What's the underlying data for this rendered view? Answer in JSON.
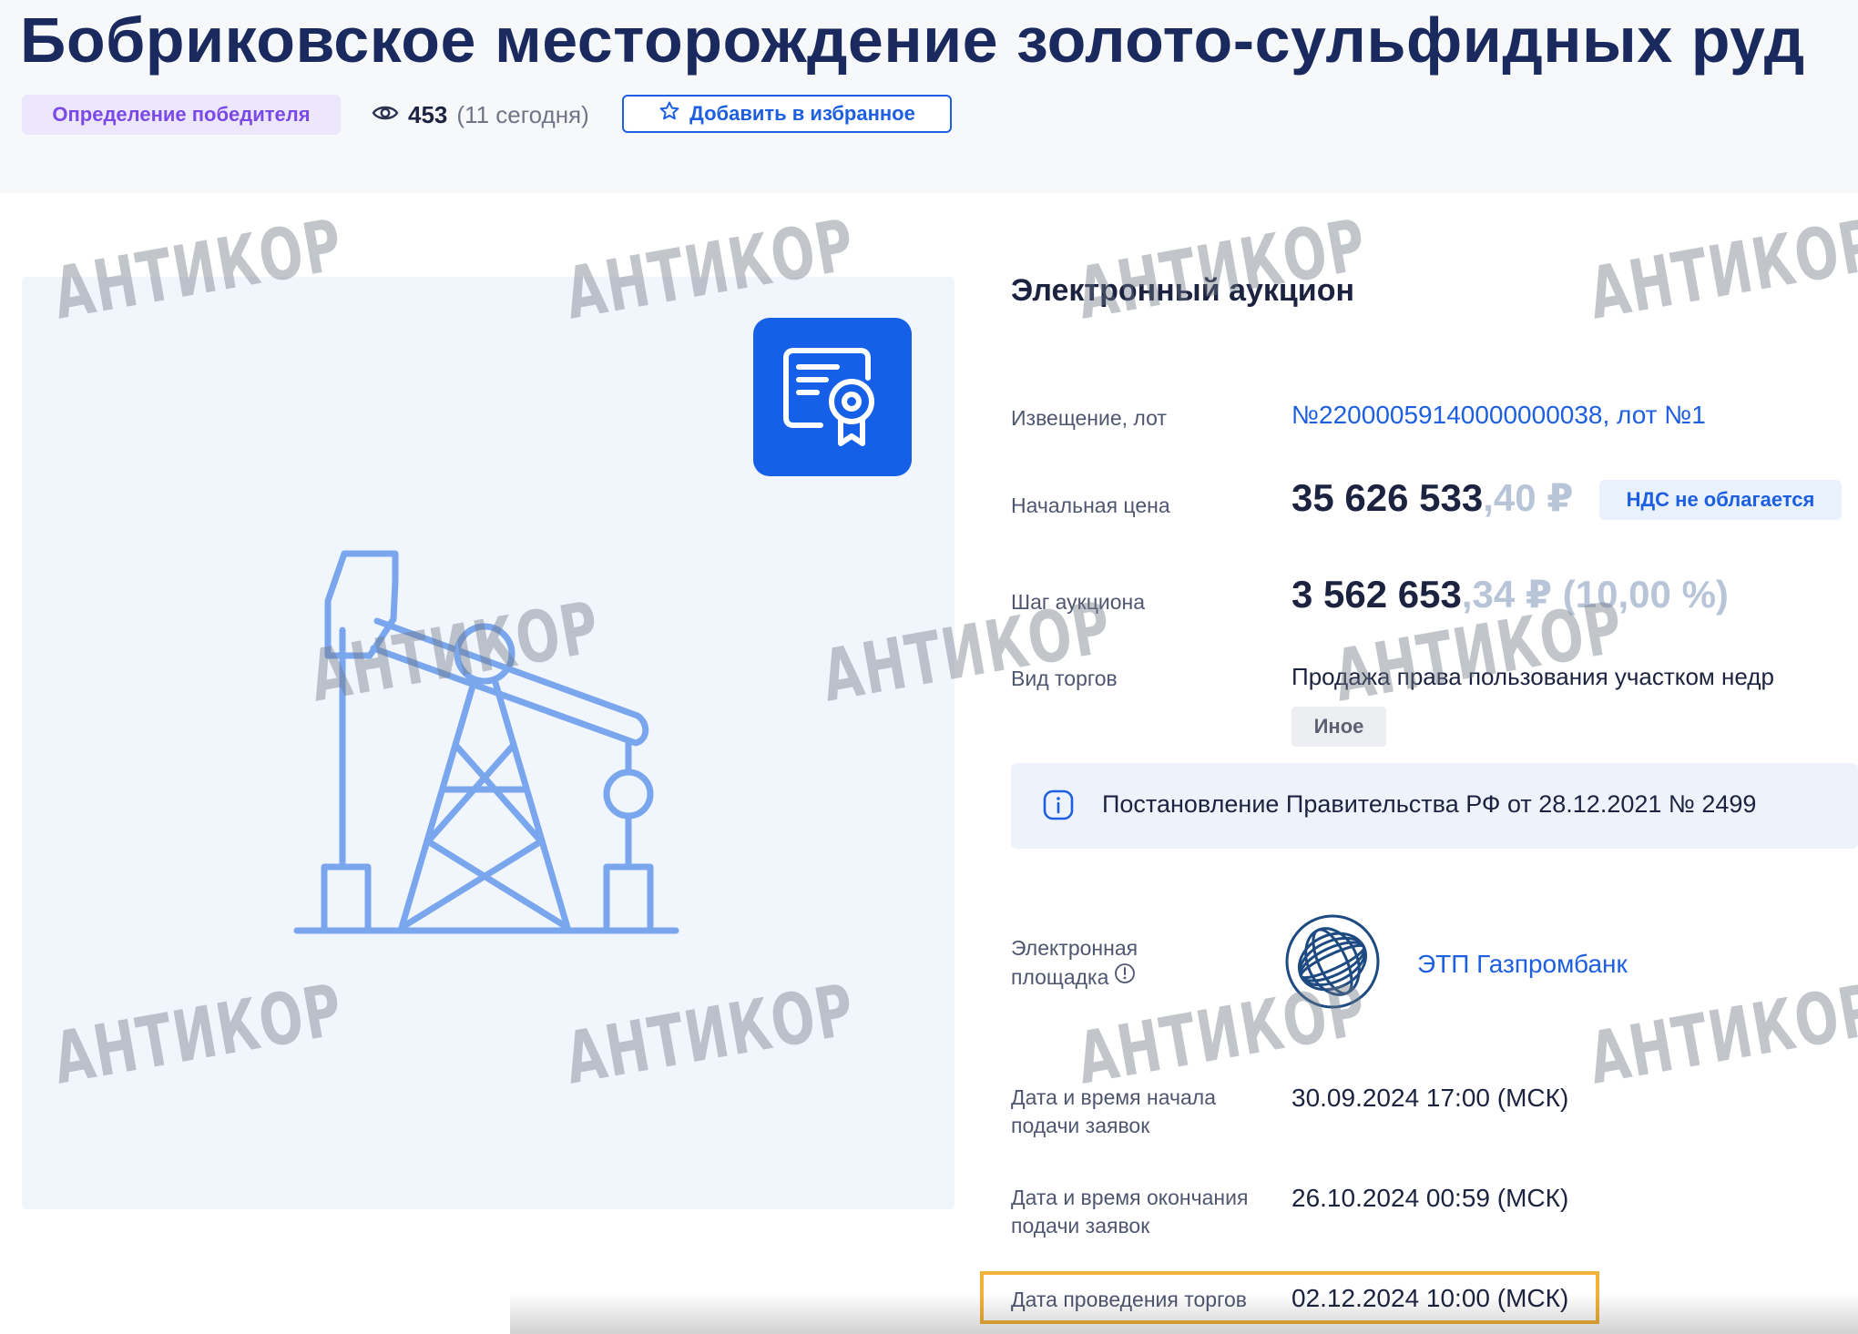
{
  "header": {
    "title": "Бобриковское месторождение золото-сульфидных руд",
    "status_badge": "Определение победителя",
    "views_count": "453",
    "views_today": "(11 сегодня)",
    "favorite_label": "Добавить в избранное"
  },
  "details": {
    "section_title": "Электронный аукцион",
    "notice": {
      "label": "Извещение, лот",
      "value": "№22000059140000000038, лот №1"
    },
    "start_price": {
      "label": "Начальная цена",
      "main": "35 626 533",
      "fraction": ",40 ₽",
      "vat_badge": "НДС не облагается"
    },
    "step": {
      "label": "Шаг аукциона",
      "main": "3 562 653",
      "fraction": ",34 ₽ (10,00 %)"
    },
    "trade_type": {
      "label": "Вид торгов",
      "value": "Продажа права пользования участком недр",
      "tag": "Иное"
    },
    "regulation_notice": "Постановление Правительства РФ от 28.12.2021 № 2499",
    "platform": {
      "label_line1": "Электронная",
      "label_line2": "площадка",
      "name": "ЭТП Газпромбанк"
    },
    "app_start": {
      "label_line1": "Дата и время начала",
      "label_line2": "подачи заявок",
      "value": "30.09.2024 17:00 (МСК)"
    },
    "app_end": {
      "label_line1": "Дата и время окончания",
      "label_line2": "подачи заявок",
      "value": "26.10.2024 00:59 (МСК)"
    },
    "auction_date": {
      "label": "Дата проведения торгов",
      "value": "02.12.2024 10:00 (МСК)"
    }
  },
  "watermark": "АНТИКОР",
  "icons": [
    "eye-icon",
    "star-icon",
    "certificate-icon",
    "pumpjack-icon",
    "info-icon",
    "gazprombank-logo"
  ],
  "colors": {
    "accent": "#1d5fe0",
    "title": "#1a2a5e",
    "status_badge_text": "#7a49e6",
    "highlight": "#f2b13b",
    "icon_tile": "#1560e6"
  }
}
